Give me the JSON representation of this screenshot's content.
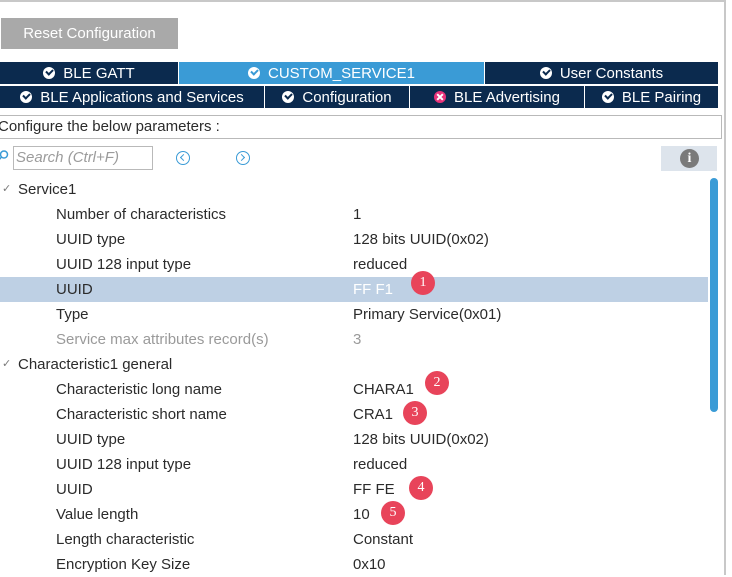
{
  "toolbar": {
    "reset_label": "Reset Configuration"
  },
  "tabs_row1": [
    {
      "label": "BLE GATT",
      "status": "ok"
    },
    {
      "label": "CUSTOM_SERVICE1",
      "status": "ok",
      "active": true
    },
    {
      "label": "User Constants",
      "status": "ok"
    }
  ],
  "tabs_row2": [
    {
      "label": "BLE Applications and Services",
      "status": "ok"
    },
    {
      "label": "Configuration",
      "status": "ok"
    },
    {
      "label": "BLE Advertising",
      "status": "error"
    },
    {
      "label": "BLE Pairing",
      "status": "ok"
    }
  ],
  "configure_label": "Configure the below parameters :",
  "search": {
    "placeholder": "Search (Ctrl+F)"
  },
  "info_icon": "i",
  "colors": {
    "tab_dark": "#0b2a4e",
    "tab_active": "#3a9bd6",
    "selected_row": "#bed0e4",
    "badge": "#e8445a",
    "error": "#e8337a"
  },
  "rows": [
    {
      "name": "Service1",
      "value": ""
    },
    {
      "name": "Number of characteristics",
      "value": "1"
    },
    {
      "name": "UUID type",
      "value": "128 bits UUID(0x02)"
    },
    {
      "name": "UUID 128 input type",
      "value": "reduced"
    },
    {
      "name": "UUID",
      "value": "FF F1",
      "badge": "1"
    },
    {
      "name": "Type",
      "value": "Primary Service(0x01)"
    },
    {
      "name": "Service max attributes record(s)",
      "value": "3"
    },
    {
      "name": "Characteristic1 general",
      "value": ""
    },
    {
      "name": "Characteristic long name",
      "value": "CHARA1",
      "badge": "2"
    },
    {
      "name": "Characteristic short name",
      "value": "CRA1",
      "badge": "3"
    },
    {
      "name": "UUID type",
      "value": "128 bits UUID(0x02)"
    },
    {
      "name": "UUID 128 input type",
      "value": "reduced"
    },
    {
      "name": "UUID",
      "value": "FF FE",
      "badge": "4"
    },
    {
      "name": "Value length",
      "value": "10",
      "badge": "5"
    },
    {
      "name": "Length characteristic",
      "value": "Constant"
    },
    {
      "name": "Encryption Key Size",
      "value": "0x10"
    }
  ]
}
